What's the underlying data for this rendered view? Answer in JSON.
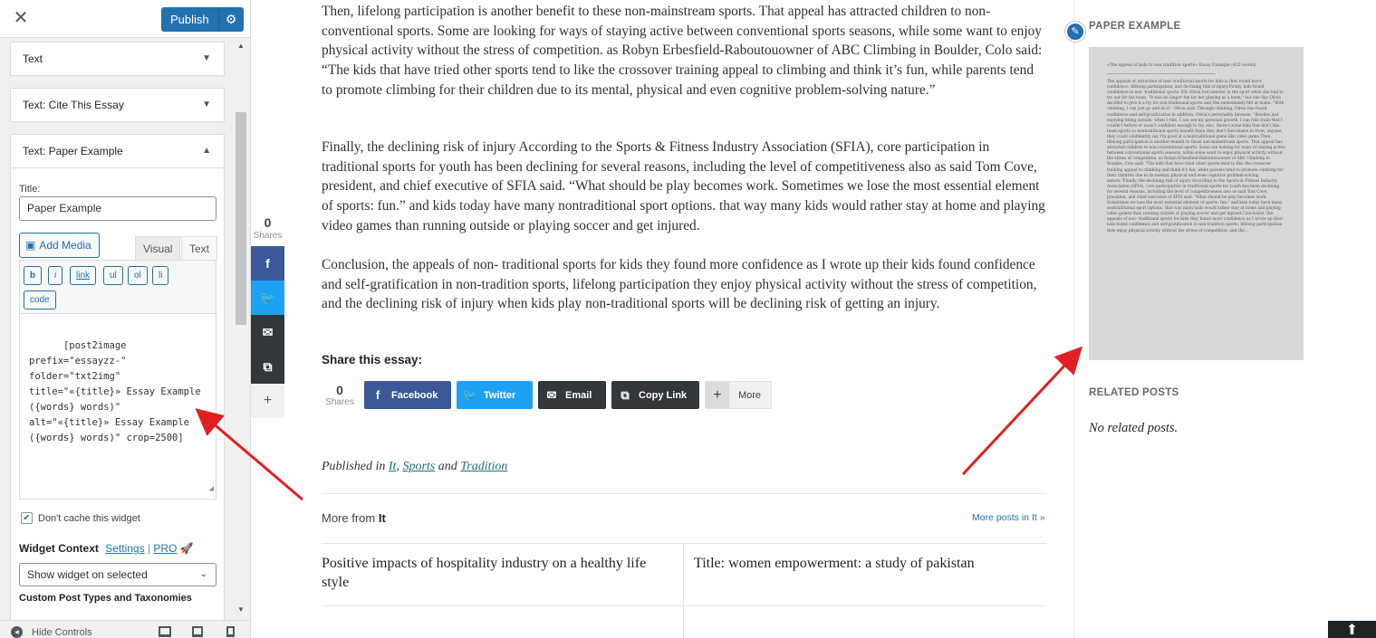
{
  "customizer": {
    "close_icon": "close-icon",
    "publish_label": "Publish",
    "widgets": [
      {
        "label": "Text"
      },
      {
        "label": "Text: Cite This Essay"
      },
      {
        "label": "Text: Paper Example"
      }
    ],
    "title_label": "Title:",
    "title_value": "Paper Example",
    "add_media_label": "Add Media",
    "tab_visual": "Visual",
    "tab_text": "Text",
    "quicktags": [
      "b",
      "i",
      "link",
      "ul",
      "ol",
      "li",
      "code"
    ],
    "editor_content": "[post2image prefix=\"essayzz-\"\nfolder=\"txt2img\"\ntitle=\"«{title}» Essay Example\n({words} words)\"\nalt=\"«{title}» Essay Example\n({words} words)\" crop=2500]",
    "dont_cache_label": "Don't cache this widget",
    "dont_cache_checked": true,
    "widget_context_label": "Widget Context",
    "settings_link": "Settings",
    "pro_link": "PRO",
    "context_select_value": "Show widget on selected",
    "custom_post_types_label": "Custom Post Types and Taxonomies",
    "hide_controls_label": "Hide Controls"
  },
  "share_sidebar": {
    "count": "0",
    "count_label": "Shares",
    "buttons": [
      {
        "icon": "facebook-icon",
        "color": "#3b5998"
      },
      {
        "icon": "twitter-icon",
        "color": "#1da1f2"
      },
      {
        "icon": "email-icon",
        "color": "#32373c"
      },
      {
        "icon": "copy-icon",
        "color": "#32373c"
      },
      {
        "icon": "plus-icon",
        "color": "#f0f0f0"
      }
    ]
  },
  "article": {
    "paragraphs": [
      "Then, lifelong participation is another benefit to these non-mainstream sports. That appeal has attracted children to non-conventional sports. Some are looking for ways of staying active between conventional sports seasons, while some want to enjoy physical activity without the stress of competition. as Robyn Erbesfield-Raboutouowner of ABC Climbing in Boulder, Colo said: “The kids that have tried other sports tend to like the crossover training appeal to climbing and think it’s fun, while parents tend to promote climbing for their children due to its mental, physical and even cognitive problem-solving nature.”",
      "Finally, the declining risk of injury According to the Sports & Fitness Industry Association (SFIA), core participation in traditional sports for youth has been declining for several reasons, including the level of competitiveness also as said Tom Cove, president, and chief executive of SFIA said. “What should be play becomes work. Sometimes we lose the most essential element of sports: fun.” and kids today have many nontraditional sport options. that way many kids would rather stay at home and playing video games than running outside or playing soccer and get injured.",
      "Conclusion, the appeals of non- traditional sports for kids they found more confidence as I wrote up their kids found confidence and self-gratification in non-tradition sports, lifelong participation they enjoy physical activity without the stress of competition, and the declining risk of injury when kids play non-traditional sports will be declining risk of getting an injury."
    ],
    "share_title": "Share this essay:",
    "share_count": "0",
    "share_count_label": "Shares",
    "share_buttons": [
      {
        "label": "Facebook",
        "icon": "facebook-icon",
        "color": "#3b5998"
      },
      {
        "label": "Twitter",
        "icon": "twitter-icon",
        "color": "#1da1f2"
      },
      {
        "label": "Email",
        "icon": "email-icon",
        "color": "#32373c"
      },
      {
        "label": "Copy Link",
        "icon": "copy-icon",
        "color": "#32373c"
      },
      {
        "label": "More",
        "icon": "plus-icon",
        "color": "#f0f0f0"
      }
    ],
    "published_prefix": "Published in",
    "categories": [
      "It",
      "Sports",
      "Tradition"
    ],
    "published_sep1": ",",
    "published_and": "and",
    "more_from_prefix": "More from",
    "more_from_category": "It",
    "more_posts_link": "More posts in It »",
    "related": [
      "Positive impacts of hospitality industry on a healthy life style",
      "Title: women empowerment: a study of pakistan"
    ]
  },
  "sidebar": {
    "paper_example_title": "PAPER EXAMPLE",
    "paper_image_title": "«The appeal of kids to non tradition sports» Essay Example (455 words)",
    "paper_image_body": "The appeals or attraction of non- traditional sports for kids is they found more confidence, lifelong participation, and declining risk of injury.Firstly, kids found confidence in non- traditional sports. EX- Olivia lost interest in the sport when she had to try out for the team. \"It was no longer fun for her playing as a team,\" but one day Olivia decided to give it a try for non-traditional sports and She immediately felt at home. \"With climbing, I can just go and do it\", Olivia said. Through climbing, Olivia has found confidence and self-gratification in addition, Olivia's personality blossom. \"Besides just enjoying being outside, when I ride, I can see my personal growth. I can ride trails that I couldn't before or wasn't confident enough to try. also, there's some kids that don't like team sports so nontraditional sports benefit them they don't feel shame in front, anyone, they could confidently say I'm good at a nontraditional game like video game.Then, lifelong participation is another benefit to these non-mainstream sports. That appeal has attracted children to non-conventional sports. Some are looking for ways of staying active between conventional sports seasons, while some want to enjoy physical activity without the stress of competition. as Robyn Erbesfield-Raboutouowner of ABC Climbing in Boulder, Colo said: \"The kids that have tried other sports tend to like the crossover training appeal to climbing and think it's fun, while parents tend to promote climbing for their children due to its mental, physical and even cognitive problem-solving nature.\"Finally, the declining risk of injury According to the Sports & Fitness Industry Association (SFIA), core participation in traditional sports for youth has been declining for several reasons, including the level of competitiveness also as said Tom Cove, president, and chief executive of SFIA said. \"What should be play becomes work. Sometimes we lose the most essential element of sports: fun.\" and kids today have many nontraditional sport options. that way many kids would rather stay at home and playing video games than running outside or playing soccer and get injured.Conclusion, the appeals of non- traditional sports for kids they found more confidence as I wrote up their kids found confidence and self-gratification in non-tradition sports, lifelong participation they enjoy physical activity without the stress of competition, and the...",
    "related_posts_title": "RELATED POSTS",
    "no_related_text": "No related posts."
  },
  "colors": {
    "accent": "#2271b1",
    "arrow": "#e02020"
  }
}
